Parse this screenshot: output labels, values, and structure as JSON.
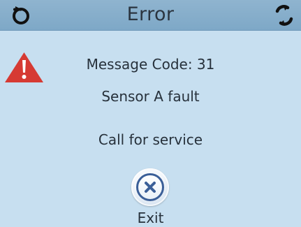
{
  "header": {
    "title": "Error",
    "left_icon": "refresh-icon",
    "right_icon": "sync-icon",
    "background_color": "#8fb4cf"
  },
  "alert": {
    "icon": "warning-triangle-icon",
    "color": "#d63a33"
  },
  "messages": {
    "code": "Message Code: 31",
    "fault": "Sensor A fault",
    "action": "Call for service"
  },
  "exit": {
    "label": "Exit",
    "icon": "close-icon",
    "icon_color": "#3b5f98"
  },
  "colors": {
    "background": "#c7dff0",
    "text": "#27313b"
  }
}
